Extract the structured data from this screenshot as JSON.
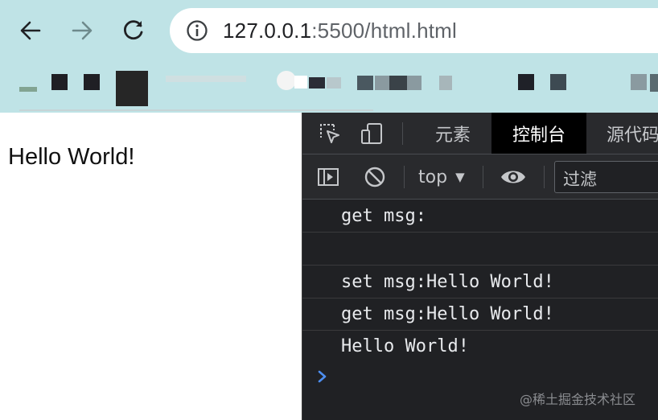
{
  "browser": {
    "url_host": "127.0.0.1",
    "url_rest": ":5500/html.html",
    "icons": {
      "back": "arrow-left-icon",
      "forward": "arrow-right-icon",
      "reload": "reload-icon",
      "site_info": "info-circle-icon"
    }
  },
  "page": {
    "text": "Hello World!"
  },
  "devtools": {
    "tabs": [
      {
        "label": "元素"
      },
      {
        "label": "控制台"
      },
      {
        "label": "源代码"
      }
    ],
    "toolbar": {
      "context": "top",
      "filter_placeholder": "过滤"
    },
    "console_logs": [
      {
        "text": "get msg:"
      },
      {
        "text": ""
      },
      {
        "text": "set msg:Hello World!"
      },
      {
        "text": "get msg:Hello World!"
      },
      {
        "text": "Hello World!"
      }
    ],
    "colors": {
      "panel_bg": "#202124",
      "toolbar_bg": "#292a2d",
      "active_tab_bg": "#000000",
      "prompt": "#4d8ef0"
    }
  },
  "watermark": "@稀土掘金技术社区"
}
